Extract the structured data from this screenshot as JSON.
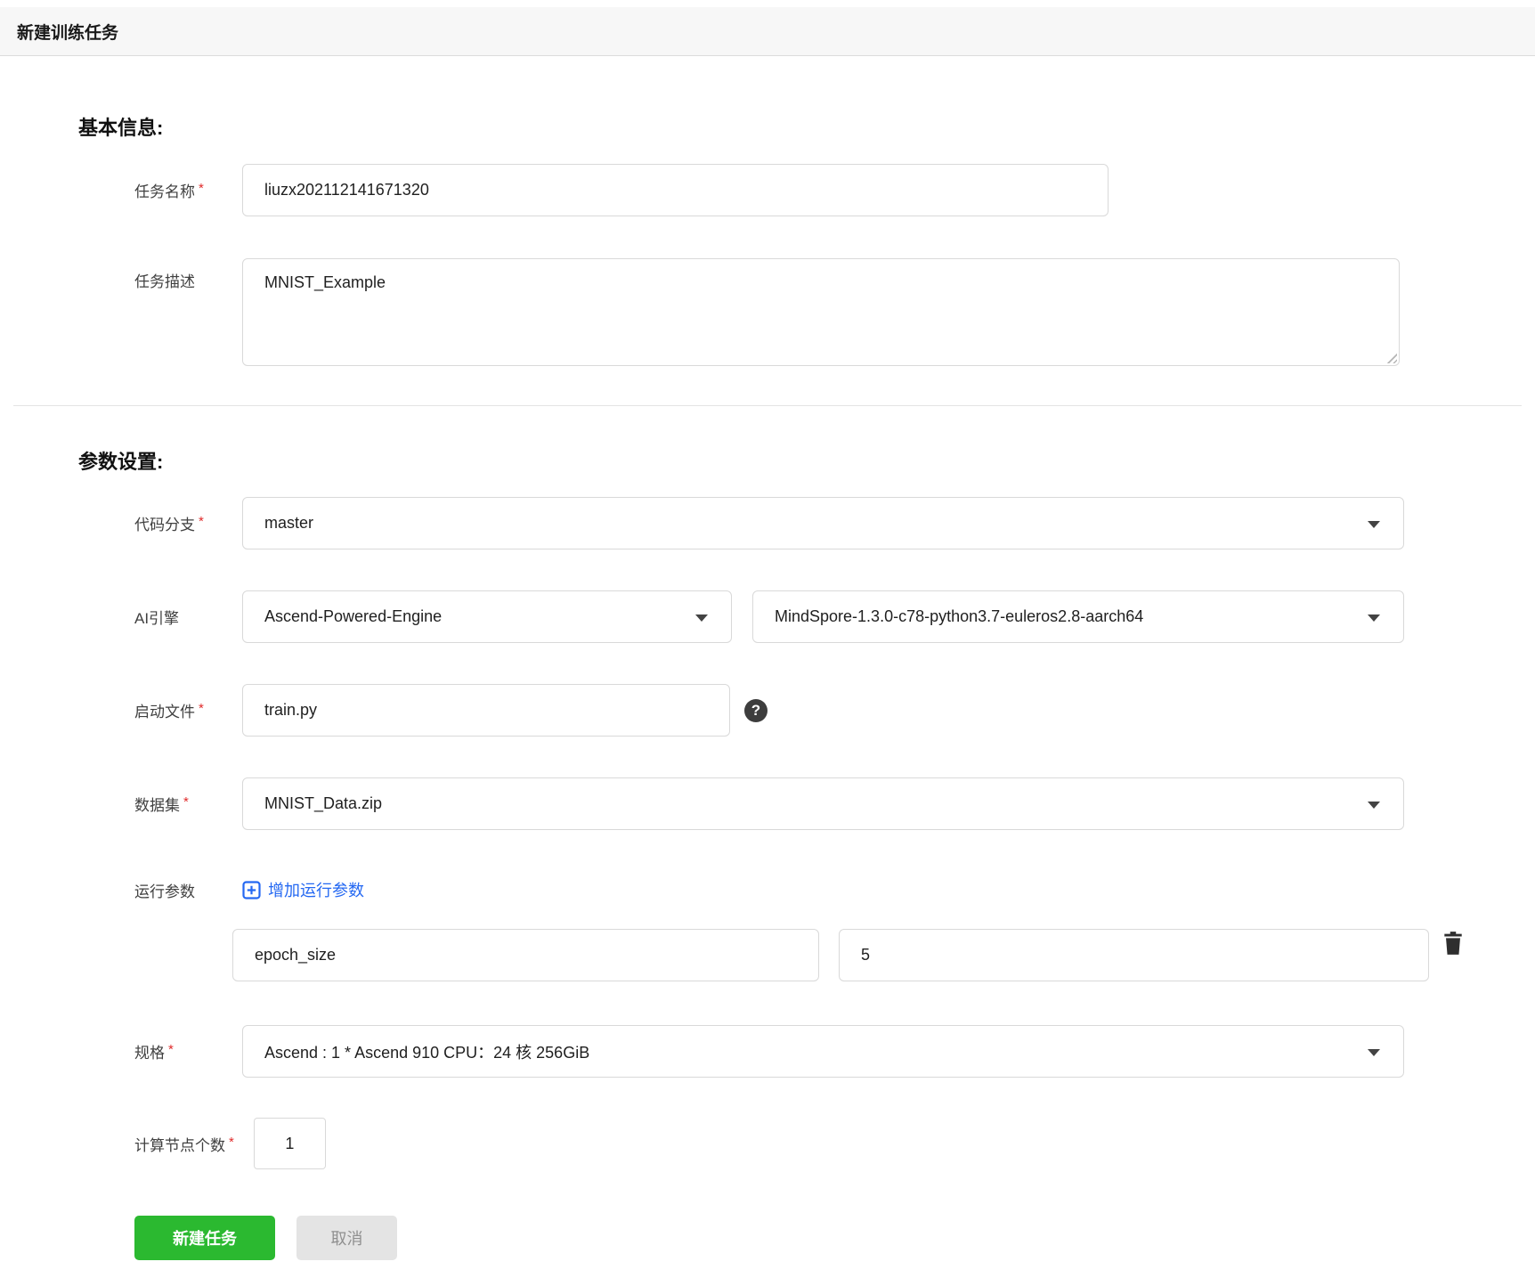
{
  "window": {
    "title": "新建训练任务"
  },
  "icons": {
    "help": "?"
  },
  "basic_info": {
    "heading": "基本信息:",
    "task_name": {
      "label": "任务名称",
      "required": true,
      "value": "liuzx202112141671320"
    },
    "task_desc": {
      "label": "任务描述",
      "required": false,
      "value": "MNIST_Example"
    }
  },
  "param_settings": {
    "heading": "参数设置:",
    "code_branch": {
      "label": "代码分支",
      "required": true,
      "value": "master"
    },
    "ai_engine": {
      "label": "AI引擎",
      "engine": "Ascend-Powered-Engine",
      "version": "MindSpore-1.3.0-c78-python3.7-euleros2.8-aarch64"
    },
    "boot_file": {
      "label": "启动文件",
      "required": true,
      "value": "train.py"
    },
    "dataset": {
      "label": "数据集",
      "required": true,
      "value": "MNIST_Data.zip"
    },
    "run_params": {
      "label": "运行参数",
      "add_label": "增加运行参数",
      "entries": [
        {
          "name": "epoch_size",
          "value": "5"
        }
      ]
    },
    "spec": {
      "label": "规格",
      "required": true,
      "value": "Ascend : 1 * Ascend 910 CPU：24 核 256GiB"
    },
    "node_count": {
      "label": "计算节点个数",
      "required": true,
      "value": "1"
    }
  },
  "actions": {
    "submit": "新建任务",
    "cancel": "取消"
  },
  "colors": {
    "accent_green": "#2bb930",
    "link_blue": "#2468f2",
    "required_red": "#e02b2b",
    "header_bg": "#f7f7f7",
    "border": "#d9d9d9"
  }
}
